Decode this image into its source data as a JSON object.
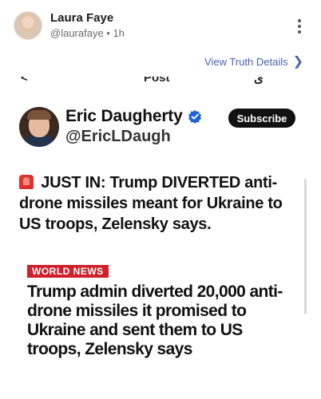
{
  "post": {
    "author_name": "Laura Faye",
    "author_meta": "@laurafaye • 1h",
    "details_link": "View Truth Details",
    "details_chevron": "❯"
  },
  "embed": {
    "cutoff_glyphs": [
      "<",
      "Post",
      "ى"
    ],
    "tweet": {
      "name": "Eric Daugherty",
      "handle": "@EricLDaugh",
      "subscribe_label": "Subscribe",
      "text": "JUST IN: Trump DIVERTED anti-drone missiles meant for Ukraine to US troops, Zelensky says."
    },
    "news_tag": "WORLD NEWS",
    "headline": "Trump admin diverted 20,000 anti-drone missiles it promised to Ukraine and sent them to US troops, Zelensky says"
  },
  "colors": {
    "link": "#4a63b8",
    "verified": "#1d63d6",
    "news_tag_bg": "#d0202a",
    "siren": "#e0312c"
  },
  "icons": [
    "more-vertical-icon",
    "chevron-right-icon",
    "verified-badge-icon",
    "siren-icon"
  ]
}
